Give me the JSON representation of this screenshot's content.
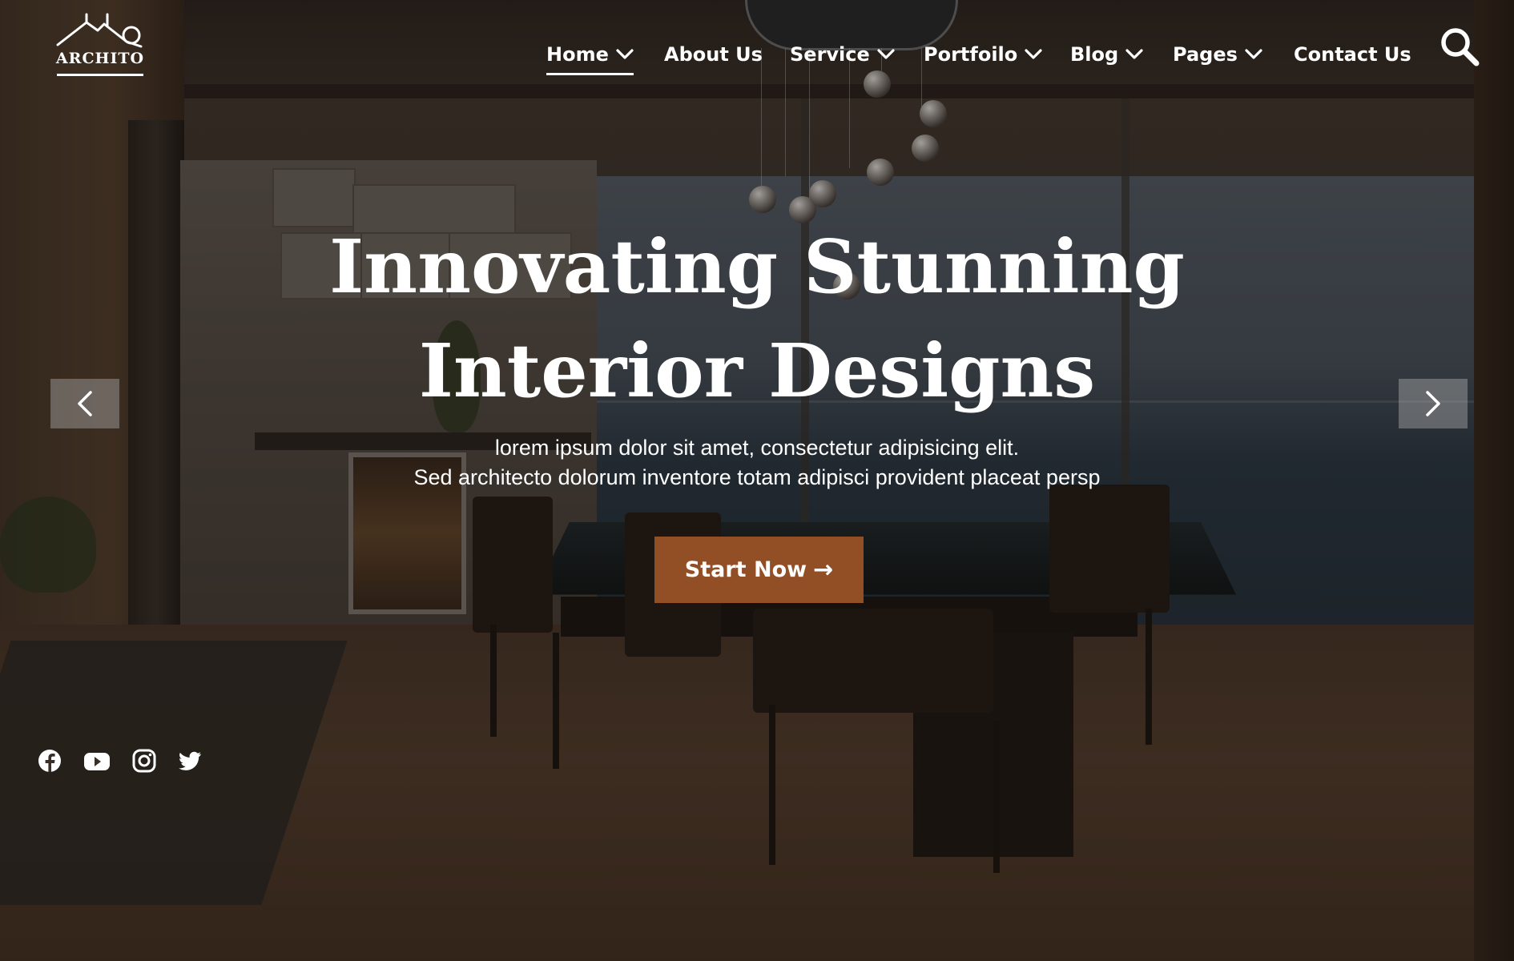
{
  "header": {
    "logo_text": "ARCHITO"
  },
  "nav": {
    "items": [
      {
        "label": "Home",
        "dropdown": true,
        "active": true
      },
      {
        "label": "About Us",
        "dropdown": false,
        "active": false
      },
      {
        "label": "Service",
        "dropdown": true,
        "active": false
      },
      {
        "label": "Portfoilo",
        "dropdown": true,
        "active": false
      },
      {
        "label": "Blog",
        "dropdown": true,
        "active": false
      },
      {
        "label": "Pages",
        "dropdown": true,
        "active": false
      },
      {
        "label": "Contact Us",
        "dropdown": false,
        "active": false
      }
    ],
    "search_icon": "search-icon"
  },
  "hero": {
    "title_line1": "Innovating Stunning",
    "title_line2": "Interior Designs",
    "subtitle_line1": "lorem ipsum dolor sit amet, consectetur adipisicing elit.",
    "subtitle_line2": "Sed architecto dolorum inventore totam adipisci provident placeat persp",
    "cta_label": "Start Now",
    "cta_arrow": "→"
  },
  "slider": {
    "prev_icon": "chevron-left-icon",
    "next_icon": "chevron-right-icon"
  },
  "social": [
    "facebook-icon",
    "youtube-icon",
    "instagram-icon",
    "twitter-icon"
  ],
  "colors": {
    "accent": "#924f25",
    "text": "#ffffff",
    "arrow_bg": "rgba(170,170,170,0.45)"
  }
}
